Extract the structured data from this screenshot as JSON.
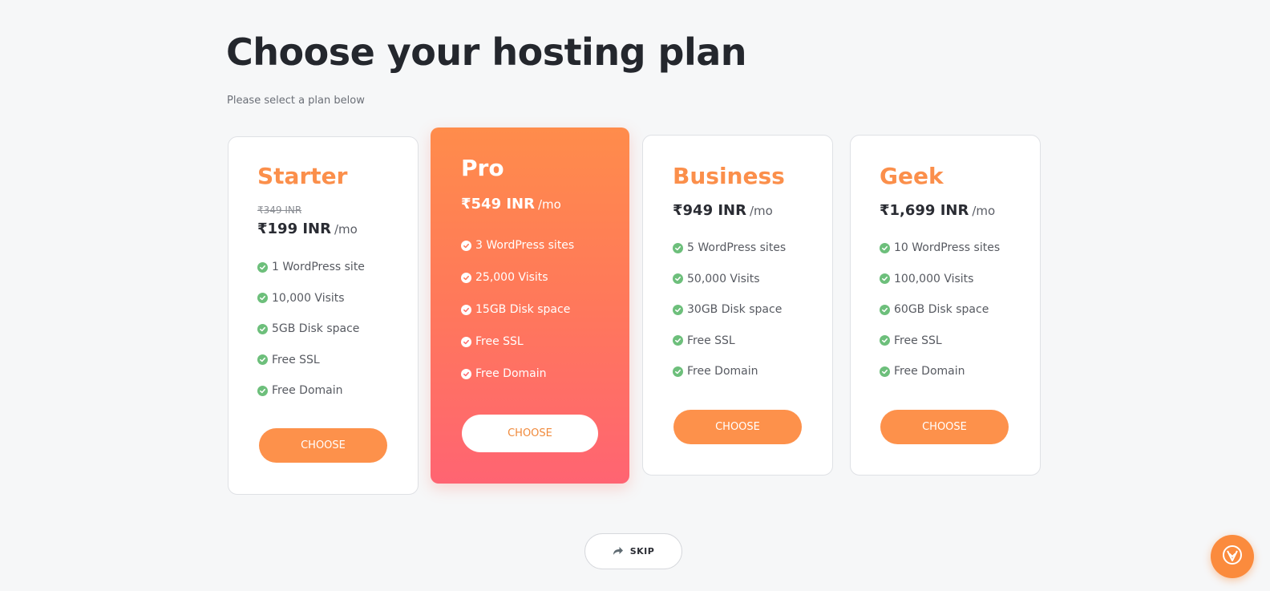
{
  "header": {
    "title": "Choose your hosting plan",
    "subtitle": "Please select a plan below"
  },
  "plans": [
    {
      "name": "Starter",
      "old_price": "₹349 INR",
      "price": "₹199 INR",
      "period": "/mo",
      "features": [
        "1 WordPress site",
        "10,000 Visits",
        "5GB Disk space",
        "Free SSL",
        "Free Domain"
      ],
      "button_label": "CHOOSE"
    },
    {
      "name": "Pro",
      "price": "₹549 INR",
      "period": "/mo",
      "featured": true,
      "features": [
        "3 WordPress sites",
        "25,000 Visits",
        "15GB Disk space",
        "Free SSL",
        "Free Domain"
      ],
      "button_label": "CHOOSE"
    },
    {
      "name": "Business",
      "price": "₹949 INR",
      "period": "/mo",
      "features": [
        "5 WordPress sites",
        "50,000 Visits",
        "30GB Disk space",
        "Free SSL",
        "Free Domain"
      ],
      "button_label": "CHOOSE"
    },
    {
      "name": "Geek",
      "price": "₹1,699 INR",
      "period": "/mo",
      "features": [
        "10 WordPress sites",
        "100,000 Visits",
        "60GB Disk space",
        "Free SSL",
        "Free Domain"
      ],
      "button_label": "CHOOSE"
    }
  ],
  "footer": {
    "skip_label": "SKIP",
    "skip_icon": "share-arrow-icon",
    "help_icon": "support-widget-icon"
  },
  "colors": {
    "accent": "#fd914b",
    "featured_gradient_top": "#ff8c4b",
    "featured_gradient_bottom": "#ff6472",
    "check": "#6dbf7b"
  }
}
